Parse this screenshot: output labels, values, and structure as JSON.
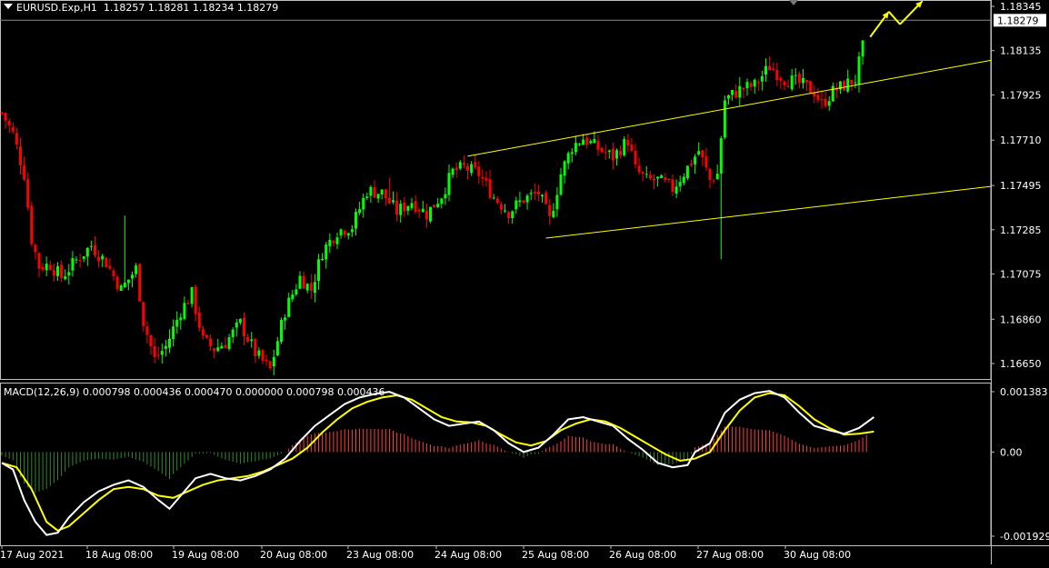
{
  "header": {
    "symbol": "EURUSD.Exp,H1",
    "ohlc": "1.18257 1.18281 1.18234 1.18279"
  },
  "macd_header": {
    "label": "MACD(12,26,9) 0.000798 0.000436 0.000470 0.000000 0.000798 0.000436"
  },
  "colors": {
    "background": "#000000",
    "grid_border": "#c0c0c0",
    "bull_candle": "#00ff00",
    "bear_candle": "#ff0000",
    "channel": "#ffff00",
    "arrow": "#ffff00",
    "macd_line": "#ffffff",
    "signal_line": "#ffff00",
    "hist_positive": "#ff4040",
    "hist_negative": "#2e8b2e",
    "axis_text": "#ffffff"
  },
  "chart_data": [
    {
      "type": "candlestick",
      "title": "EURUSD.Exp,H1",
      "y_ticks": [
        "1.18345",
        "1.18135",
        "1.17925",
        "1.17710",
        "1.17495",
        "1.17285",
        "1.17075",
        "1.16860",
        "1.16650"
      ],
      "ylim": [
        1.166,
        1.1837
      ],
      "current_price": "1.18279",
      "x_ticks": [
        "17 Aug 2021",
        "18 Aug 08:00",
        "19 Aug 08:00",
        "20 Aug 08:00",
        "23 Aug 08:00",
        "24 Aug 08:00",
        "25 Aug 08:00",
        "26 Aug 08:00",
        "27 Aug 08:00",
        "30 Aug 08:00"
      ],
      "xlim": [
        0,
        230
      ],
      "close_path": [
        [
          0,
          1.1784
        ],
        [
          3,
          1.1774
        ],
        [
          6,
          1.1755
        ],
        [
          8,
          1.1724
        ],
        [
          10,
          1.1711
        ],
        [
          13,
          1.1712
        ],
        [
          16,
          1.1706
        ],
        [
          20,
          1.1714
        ],
        [
          24,
          1.1721
        ],
        [
          28,
          1.1713
        ],
        [
          32,
          1.17
        ],
        [
          36,
          1.171
        ],
        [
          38,
          1.1685
        ],
        [
          41,
          1.1667
        ],
        [
          44,
          1.1673
        ],
        [
          48,
          1.169
        ],
        [
          51,
          1.1698
        ],
        [
          54,
          1.1676
        ],
        [
          57,
          1.1672
        ],
        [
          60,
          1.1675
        ],
        [
          64,
          1.1684
        ],
        [
          68,
          1.167
        ],
        [
          72,
          1.1662
        ],
        [
          76,
          1.169
        ],
        [
          80,
          1.1706
        ],
        [
          83,
          1.17
        ],
        [
          86,
          1.1718
        ],
        [
          90,
          1.1728
        ],
        [
          94,
          1.173
        ],
        [
          98,
          1.1747
        ],
        [
          102,
          1.1746
        ],
        [
          106,
          1.1737
        ],
        [
          110,
          1.1742
        ],
        [
          114,
          1.1736
        ],
        [
          118,
          1.1745
        ],
        [
          121,
          1.1756
        ],
        [
          124,
          1.1758
        ],
        [
          128,
          1.1755
        ],
        [
          132,
          1.1744
        ],
        [
          136,
          1.1737
        ],
        [
          140,
          1.1743
        ],
        [
          144,
          1.1746
        ],
        [
          147,
          1.1733
        ],
        [
          150,
          1.1755
        ],
        [
          153,
          1.1768
        ],
        [
          156,
          1.1772
        ],
        [
          160,
          1.1767
        ],
        [
          164,
          1.1763
        ],
        [
          168,
          1.1771
        ],
        [
          170,
          1.1757
        ],
        [
          173,
          1.1752
        ],
        [
          176,
          1.1752
        ],
        [
          180,
          1.1748
        ],
        [
          184,
          1.1758
        ],
        [
          187,
          1.1766
        ],
        [
          190,
          1.1752
        ],
        [
          192,
          1.1755
        ],
        [
          194,
          1.179
        ],
        [
          198,
          1.1795
        ],
        [
          202,
          1.1797
        ],
        [
          206,
          1.1806
        ],
        [
          210,
          1.18
        ],
        [
          214,
          1.1798
        ],
        [
          218,
          1.1794
        ],
        [
          220,
          1.1788
        ],
        [
          223,
          1.1794
        ],
        [
          226,
          1.1797
        ],
        [
          229,
          1.18
        ],
        [
          231,
          1.1815
        ],
        [
          233,
          1.1828
        ]
      ],
      "channel_lines": [
        {
          "x1": 125,
          "y1": 1.17634,
          "x2": 270,
          "y2": 1.18104
        },
        {
          "x1": 146,
          "y1": 1.17245,
          "x2": 270,
          "y2": 1.175
        }
      ],
      "arrows": [
        {
          "from": [
            233,
            1.182
          ],
          "to": [
            238,
            1.1832
          ]
        },
        {
          "from": [
            238,
            1.1832
          ],
          "to": [
            241,
            1.1826
          ]
        },
        {
          "from": [
            241,
            1.1826
          ],
          "to": [
            247,
            1.1837
          ]
        }
      ]
    },
    {
      "type": "line+bar",
      "title": "MACD(12,26,9)",
      "y_ticks": [
        "0.001383",
        "0.00",
        "-0.001929"
      ],
      "ylim": [
        -0.001929,
        0.001383
      ],
      "series": [
        {
          "name": "MACD",
          "points": [
            [
              0,
              -0.00025
            ],
            [
              3,
              -0.0004
            ],
            [
              6,
              -0.0011
            ],
            [
              9,
              -0.0016
            ],
            [
              12,
              -0.0019
            ],
            [
              15,
              -0.00185
            ],
            [
              18,
              -0.0015
            ],
            [
              22,
              -0.00115
            ],
            [
              26,
              -0.0009
            ],
            [
              30,
              -0.00075
            ],
            [
              34,
              -0.00065
            ],
            [
              38,
              -0.0008
            ],
            [
              42,
              -0.0011
            ],
            [
              45,
              -0.0013
            ],
            [
              48,
              -0.001
            ],
            [
              52,
              -0.0006
            ],
            [
              56,
              -0.0005
            ],
            [
              60,
              -0.0006
            ],
            [
              64,
              -0.00065
            ],
            [
              68,
              -0.00055
            ],
            [
              72,
              -0.0004
            ],
            [
              76,
              -0.00015
            ],
            [
              80,
              0.00025
            ],
            [
              84,
              0.0006
            ],
            [
              88,
              0.00085
            ],
            [
              92,
              0.0011
            ],
            [
              96,
              0.00125
            ],
            [
              100,
              0.00133
            ],
            [
              104,
              0.00138
            ],
            [
              108,
              0.00125
            ],
            [
              112,
              0.001
            ],
            [
              116,
              0.00075
            ],
            [
              120,
              0.0006
            ],
            [
              124,
              0.00065
            ],
            [
              128,
              0.0007
            ],
            [
              132,
              0.0005
            ],
            [
              136,
              0.0002
            ],
            [
              140,
              0.0
            ],
            [
              144,
              0.0001
            ],
            [
              148,
              0.0004
            ],
            [
              152,
              0.00075
            ],
            [
              156,
              0.0008
            ],
            [
              160,
              0.0007
            ],
            [
              164,
              0.0006
            ],
            [
              168,
              0.0003
            ],
            [
              172,
              5e-05
            ],
            [
              176,
              -0.00025
            ],
            [
              180,
              -0.00035
            ],
            [
              184,
              -0.0003
            ],
            [
              186,
              0.0
            ],
            [
              190,
              0.0002
            ],
            [
              194,
              0.0009
            ],
            [
              198,
              0.0012
            ],
            [
              202,
              0.00135
            ],
            [
              206,
              0.0014
            ],
            [
              210,
              0.00125
            ],
            [
              214,
              0.0009
            ],
            [
              218,
              0.0006
            ],
            [
              222,
              0.0005
            ],
            [
              226,
              0.00042
            ],
            [
              230,
              0.00055
            ],
            [
              234,
              0.0008
            ]
          ]
        },
        {
          "name": "Signal",
          "points": [
            [
              0,
              -0.00025
            ],
            [
              4,
              -0.00035
            ],
            [
              8,
              -0.00085
            ],
            [
              12,
              -0.0016
            ],
            [
              15,
              -0.0018
            ],
            [
              18,
              -0.0017
            ],
            [
              22,
              -0.0014
            ],
            [
              26,
              -0.0011
            ],
            [
              30,
              -0.00085
            ],
            [
              34,
              -0.0008
            ],
            [
              38,
              -0.00085
            ],
            [
              42,
              -0.001
            ],
            [
              46,
              -0.00105
            ],
            [
              50,
              -0.0009
            ],
            [
              54,
              -0.00075
            ],
            [
              58,
              -0.00065
            ],
            [
              62,
              -0.0006
            ],
            [
              66,
              -0.00055
            ],
            [
              70,
              -0.00045
            ],
            [
              74,
              -0.0003
            ],
            [
              78,
              -0.00015
            ],
            [
              82,
              0.0001
            ],
            [
              86,
              0.00045
            ],
            [
              90,
              0.00075
            ],
            [
              94,
              0.001
            ],
            [
              98,
              0.00115
            ],
            [
              102,
              0.00125
            ],
            [
              106,
              0.0013
            ],
            [
              110,
              0.0012
            ],
            [
              114,
              0.001
            ],
            [
              118,
              0.0008
            ],
            [
              122,
              0.0007
            ],
            [
              126,
              0.00068
            ],
            [
              130,
              0.0006
            ],
            [
              134,
              0.0004
            ],
            [
              138,
              0.00022
            ],
            [
              142,
              0.00015
            ],
            [
              146,
              0.00025
            ],
            [
              150,
              0.0005
            ],
            [
              154,
              0.00065
            ],
            [
              158,
              0.00075
            ],
            [
              162,
              0.0007
            ],
            [
              166,
              0.00055
            ],
            [
              170,
              0.00035
            ],
            [
              174,
              0.00015
            ],
            [
              178,
              -5e-05
            ],
            [
              182,
              -0.0002
            ],
            [
              186,
              -0.00015
            ],
            [
              190,
              0.0
            ],
            [
              194,
              0.0005
            ],
            [
              198,
              0.00095
            ],
            [
              202,
              0.00125
            ],
            [
              206,
              0.00135
            ],
            [
              210,
              0.0013
            ],
            [
              214,
              0.00105
            ],
            [
              218,
              0.00075
            ],
            [
              222,
              0.00055
            ],
            [
              226,
              0.0004
            ],
            [
              230,
              0.00042
            ],
            [
              234,
              0.00047
            ]
          ]
        }
      ]
    }
  ]
}
